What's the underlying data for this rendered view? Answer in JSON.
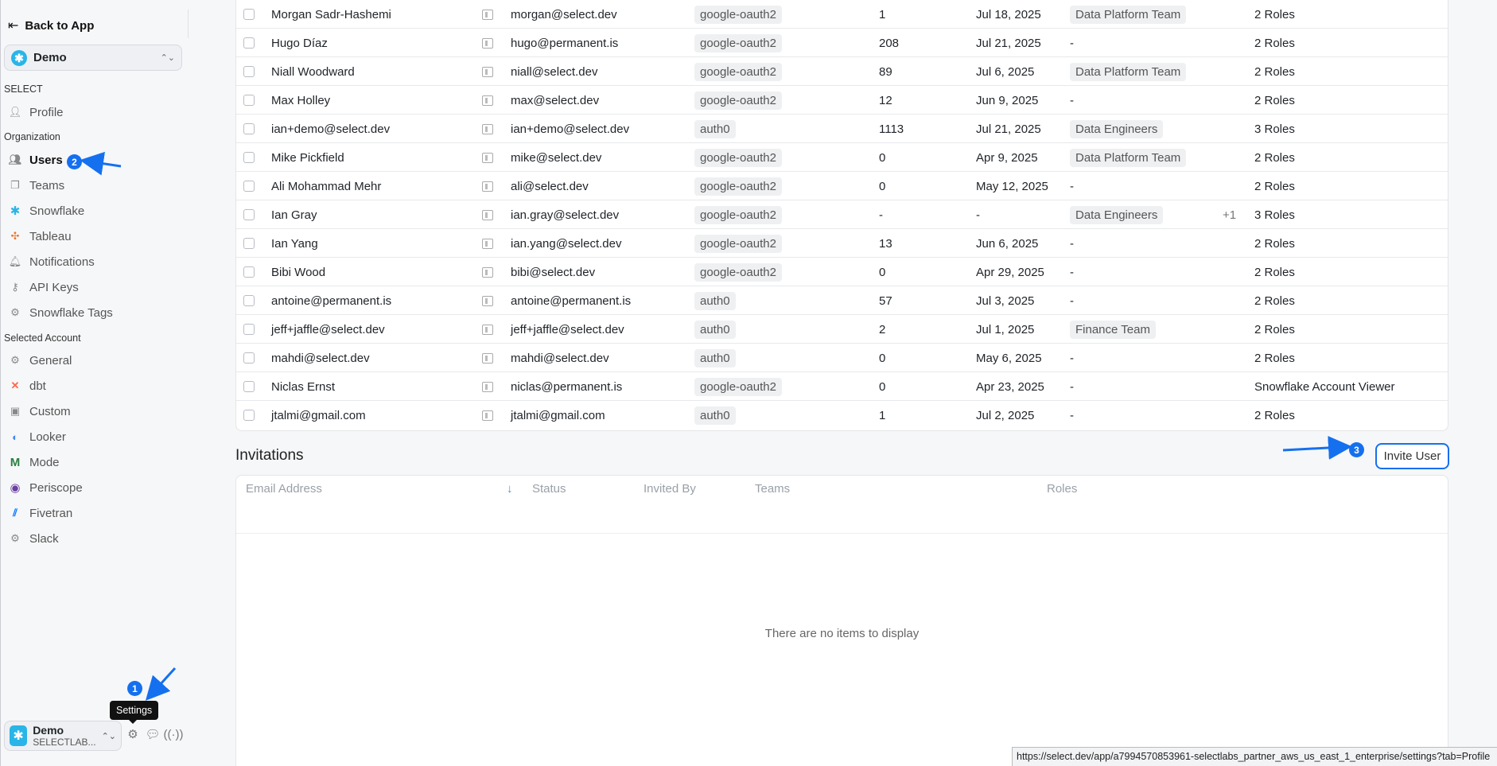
{
  "sidebar": {
    "back_label": "Back to App",
    "workspace": "Demo",
    "sections": {
      "select": "SELECT",
      "organization": "Organization",
      "selected_account": "Selected Account"
    },
    "items": [
      {
        "label": "Profile",
        "icon": "person-icon"
      },
      {
        "label": "Users",
        "icon": "users-icon",
        "active": true
      },
      {
        "label": "Teams",
        "icon": "teams-icon"
      },
      {
        "label": "Snowflake",
        "icon": "snowflake-icon"
      },
      {
        "label": "Tableau",
        "icon": "tableau-icon"
      },
      {
        "label": "Notifications",
        "icon": "bell-icon"
      },
      {
        "label": "API Keys",
        "icon": "key-icon"
      },
      {
        "label": "Snowflake Tags",
        "icon": "gear-icon"
      },
      {
        "label": "General",
        "icon": "gear-icon"
      },
      {
        "label": "dbt",
        "icon": "dbt-icon"
      },
      {
        "label": "Custom",
        "icon": "custom-icon"
      },
      {
        "label": "Looker",
        "icon": "looker-icon"
      },
      {
        "label": "Mode",
        "icon": "mode-icon"
      },
      {
        "label": "Periscope",
        "icon": "periscope-icon"
      },
      {
        "label": "Fivetran",
        "icon": "fivetran-icon"
      },
      {
        "label": "Slack",
        "icon": "gear-icon"
      }
    ],
    "account": {
      "name": "Demo",
      "sub": "SELECTLAB..."
    },
    "tooltip": "Settings"
  },
  "annotations": {
    "step1": "1",
    "step2": "2",
    "step3": "3"
  },
  "users": [
    {
      "name": "Morgan Sadr-Hashemi",
      "email": "morgan@select.dev",
      "auth": "google-oauth2",
      "count": "1",
      "date": "Jul 18, 2025",
      "team": "Data Platform Team",
      "extra": "",
      "roles": "2 Roles"
    },
    {
      "name": "Hugo Díaz",
      "email": "hugo@permanent.is",
      "auth": "google-oauth2",
      "count": "208",
      "date": "Jul 21, 2025",
      "team": "",
      "extra": "",
      "roles": "2 Roles"
    },
    {
      "name": "Niall Woodward",
      "email": "niall@select.dev",
      "auth": "google-oauth2",
      "count": "89",
      "date": "Jul 6, 2025",
      "team": "Data Platform Team",
      "extra": "",
      "roles": "2 Roles"
    },
    {
      "name": "Max Holley",
      "email": "max@select.dev",
      "auth": "google-oauth2",
      "count": "12",
      "date": "Jun 9, 2025",
      "team": "",
      "extra": "",
      "roles": "2 Roles"
    },
    {
      "name": "ian+demo@select.dev",
      "email": "ian+demo@select.dev",
      "auth": "auth0",
      "count": "1113",
      "date": "Jul 21, 2025",
      "team": "Data Engineers",
      "extra": "",
      "roles": "3 Roles"
    },
    {
      "name": "Mike Pickfield",
      "email": "mike@select.dev",
      "auth": "google-oauth2",
      "count": "0",
      "date": "Apr 9, 2025",
      "team": "Data Platform Team",
      "extra": "",
      "roles": "2 Roles"
    },
    {
      "name": "Ali Mohammad Mehr",
      "email": "ali@select.dev",
      "auth": "google-oauth2",
      "count": "0",
      "date": "May 12, 2025",
      "team": "",
      "extra": "",
      "roles": "2 Roles"
    },
    {
      "name": "Ian Gray",
      "email": "ian.gray@select.dev",
      "auth": "google-oauth2",
      "count": "-",
      "date": "-",
      "team": "Data Engineers",
      "extra": "+1",
      "roles": "3 Roles"
    },
    {
      "name": "Ian Yang",
      "email": "ian.yang@select.dev",
      "auth": "google-oauth2",
      "count": "13",
      "date": "Jun 6, 2025",
      "team": "",
      "extra": "",
      "roles": "2 Roles"
    },
    {
      "name": "Bibi Wood",
      "email": "bibi@select.dev",
      "auth": "google-oauth2",
      "count": "0",
      "date": "Apr 29, 2025",
      "team": "",
      "extra": "",
      "roles": "2 Roles"
    },
    {
      "name": "antoine@permanent.is",
      "email": "antoine@permanent.is",
      "auth": "auth0",
      "count": "57",
      "date": "Jul 3, 2025",
      "team": "",
      "extra": "",
      "roles": "2 Roles"
    },
    {
      "name": "jeff+jaffle@select.dev",
      "email": "jeff+jaffle@select.dev",
      "auth": "auth0",
      "count": "2",
      "date": "Jul 1, 2025",
      "team": "Finance Team",
      "extra": "",
      "roles": "2 Roles"
    },
    {
      "name": "mahdi@select.dev",
      "email": "mahdi@select.dev",
      "auth": "auth0",
      "count": "0",
      "date": "May 6, 2025",
      "team": "",
      "extra": "",
      "roles": "2 Roles"
    },
    {
      "name": "Niclas Ernst",
      "email": "niclas@permanent.is",
      "auth": "google-oauth2",
      "count": "0",
      "date": "Apr 23, 2025",
      "team": "",
      "extra": "",
      "roles": "Snowflake Account Viewer"
    },
    {
      "name": "jtalmi@gmail.com",
      "email": "jtalmi@gmail.com",
      "auth": "auth0",
      "count": "1",
      "date": "Jul 2, 2025",
      "team": "",
      "extra": "",
      "roles": "2 Roles"
    }
  ],
  "empty_team": "-",
  "invitations": {
    "title": "Invitations",
    "invite_button": "Invite User",
    "columns": [
      "Email Address",
      "Status",
      "Invited By",
      "Teams",
      "Roles"
    ],
    "empty_text": "There are no items to display"
  },
  "status_url": "https://select.dev/app/a7994570853961-selectlabs_partner_aws_us_east_1_enterprise/settings?tab=Profile",
  "colors": {
    "accent": "#1570ef",
    "snowflake": "#29b5e8"
  }
}
